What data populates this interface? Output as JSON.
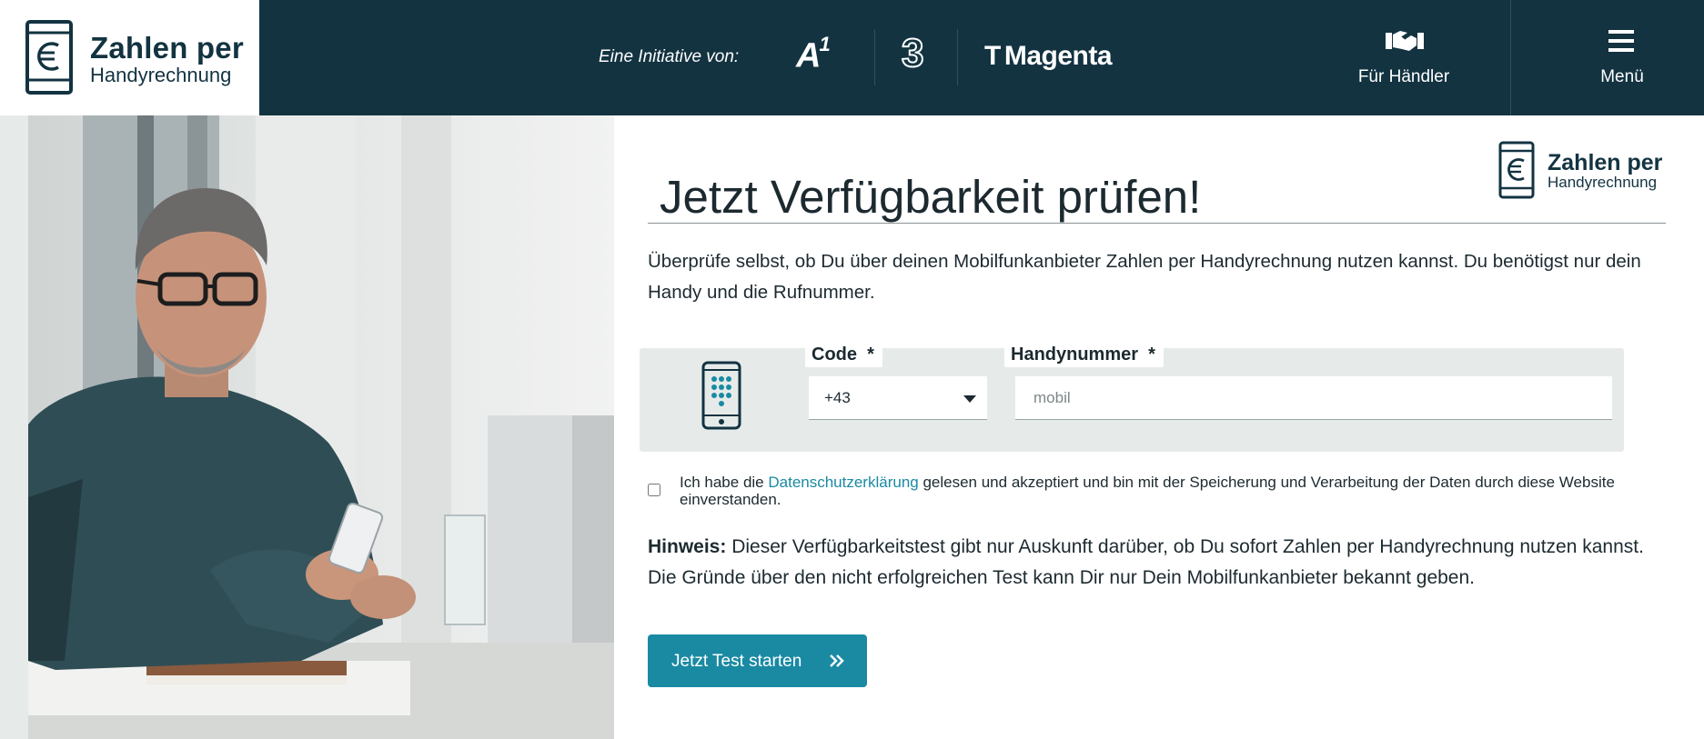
{
  "header": {
    "logo": {
      "line1": "Zahlen per",
      "line2": "Handyrechnung"
    },
    "initiative_label": "Eine Initiative von:",
    "brands": [
      {
        "name": "A1",
        "icon": "a1-logo"
      },
      {
        "name": "3",
        "icon": "three-logo"
      },
      {
        "name": "Magenta",
        "prefix": "T",
        "icon": "magenta-logo"
      }
    ],
    "dealer_label": "Für Händler",
    "dealer_icon": "handshake-icon",
    "menu_label": "Menü",
    "menu_icon": "hamburger-icon"
  },
  "main": {
    "title": "Jetzt Verfügbarkeit prüfen!",
    "logo": {
      "line1": "Zahlen per",
      "line2": "Handyrechnung"
    },
    "intro": "Überprüfe selbst, ob Du über deinen Mobilfunkanbieter Zahlen per Handyrechnung nutzen kannst. Du benötigst nur dein Handy und die Rufnummer.",
    "form": {
      "code_label": "Code",
      "code_required": "*",
      "code_value": "+43",
      "phone_label": "Handynummer",
      "phone_required": "*",
      "phone_placeholder": "mobil",
      "phone_value": ""
    },
    "consent": {
      "checked": false,
      "before": "Ich habe die ",
      "link": "Datenschutzerklärung",
      "after": " gelesen und akzeptiert und bin mit der Speicherung und Verarbeitung der Daten durch diese Website einverstanden."
    },
    "hint": {
      "label": "Hinweis:",
      "text": " Dieser Verfügbarkeitstest gibt nur Auskunft darüber, ob Du sofort Zahlen per Handyrechnung nutzen kannst. Die Gründe über den nicht erfolgreichen Test kann Dir nur Dein Mobilfunkanbieter bekannt geben."
    },
    "cta_label": "Jetzt Test starten",
    "cta_icon": "double-chevron-right-icon"
  },
  "colors": {
    "header_bg": "#133341",
    "accent": "#1a8aa3",
    "panel_bg": "#e6ebea",
    "text": "#1c2a30"
  }
}
